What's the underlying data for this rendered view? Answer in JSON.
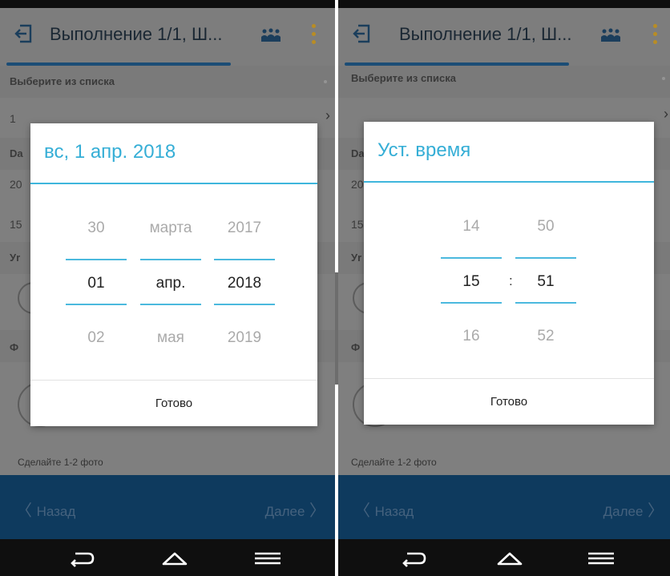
{
  "app": {
    "title": "Выполнение 1/1, Ш...",
    "accent": "#3fb6dc",
    "brand": "#0e3a5e"
  },
  "form": {
    "list_label": "Выберите из списка",
    "list_value": "1",
    "date_label_partial": "Da",
    "date_value_partial": "20",
    "time_value_partial": "15",
    "user_label_partial": "Уr",
    "photo_label_partial": "Ф",
    "photo_hint": "Сделайте 1-2 фото"
  },
  "nav": {
    "back_label": "Назад",
    "next_label": "Далее"
  },
  "date_dialog": {
    "title": "вс, 1 апр. 2018",
    "days": {
      "prev": "30",
      "selected": "01",
      "next": "02"
    },
    "months": {
      "prev": "марта",
      "selected": "апр.",
      "next": "мая"
    },
    "years": {
      "prev": "2017",
      "selected": "2018",
      "next": "2019"
    },
    "done_label": "Готово"
  },
  "time_dialog": {
    "title": "Уст. время",
    "hours": {
      "prev": "14",
      "selected": "15",
      "next": "16"
    },
    "minutes": {
      "prev": "50",
      "selected": "51",
      "next": "52"
    },
    "separator": ":",
    "done_label": "Готово"
  },
  "icons": {
    "back": "exit-arrow-icon",
    "team": "team-icon",
    "more": "more-vertical-icon",
    "sys_back": "system-back-icon",
    "sys_home": "home-icon",
    "sys_menu": "menu-icon"
  }
}
